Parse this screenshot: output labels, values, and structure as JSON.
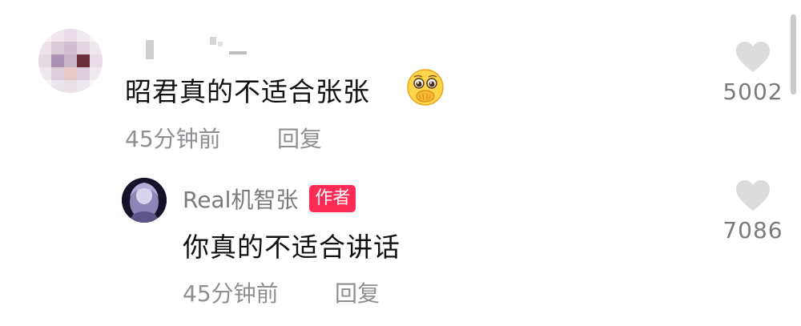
{
  "colors": {
    "text_primary": "#111111",
    "text_meta": "#8e8e93",
    "badge_bg": "#fe2c55",
    "like_icon": "#dcdcdc",
    "scrollbar": "#c9c9cc"
  },
  "comment": {
    "username_obscured": true,
    "text": "昭君真的不适合张张",
    "emoji": "shy-covering-mouth-emoji",
    "time": "45分钟前",
    "reply_label": "回复",
    "likes": "5002"
  },
  "reply": {
    "username": "Real机智张",
    "badge": "作者",
    "text": "你真的不适合讲话",
    "time": "45分钟前",
    "reply_label": "回复",
    "likes": "7086"
  },
  "icons": {
    "like": "heart-icon",
    "avatar_commenter": "pixelated-avatar",
    "avatar_author": "author-avatar"
  }
}
